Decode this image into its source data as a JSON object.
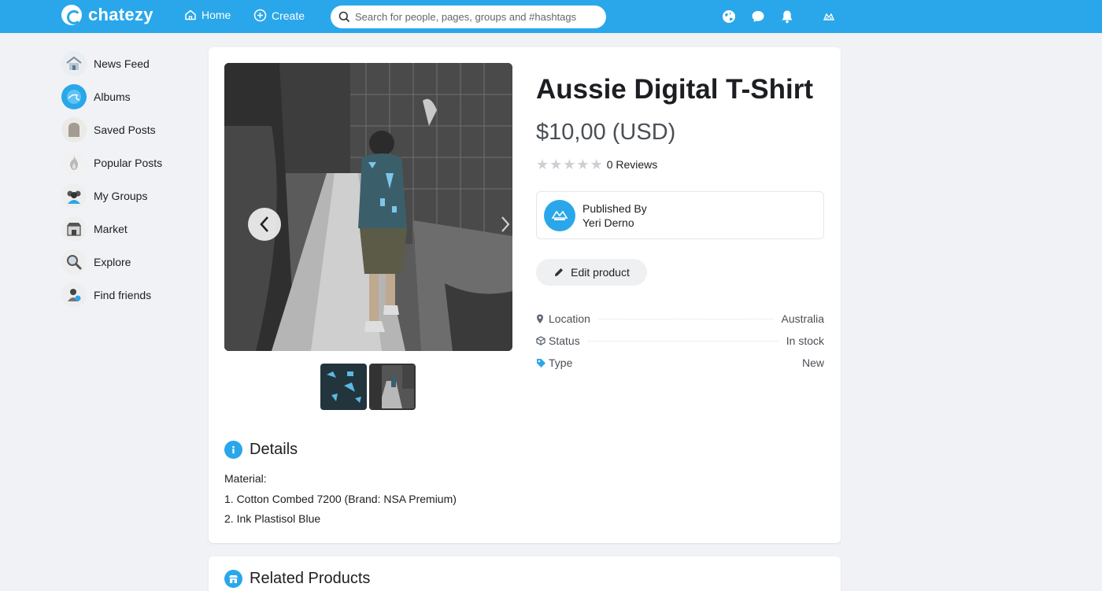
{
  "header": {
    "brand": "chatezy",
    "nav": {
      "home": "Home",
      "create": "Create"
    },
    "search_placeholder": "Search for people, pages, groups and #hashtags",
    "icons": [
      "globe-icon",
      "chat-icon",
      "bell-icon",
      "user-menu-icon"
    ],
    "brand_color": "#2aa7ea"
  },
  "sidebar": {
    "items": [
      {
        "label": "News Feed",
        "icon": "house-icon"
      },
      {
        "label": "Albums",
        "icon": "albums-icon"
      },
      {
        "label": "Saved Posts",
        "icon": "bookmark-icon"
      },
      {
        "label": "Popular Posts",
        "icon": "flame-icon"
      },
      {
        "label": "My Groups",
        "icon": "groups-icon"
      },
      {
        "label": "Market",
        "icon": "market-icon"
      },
      {
        "label": "Explore",
        "icon": "magnifier-icon"
      },
      {
        "label": "Find friends",
        "icon": "find-friends-icon"
      }
    ]
  },
  "product": {
    "title": "Aussie Digital T-Shirt",
    "price": "$10,00 (USD)",
    "rating_stars": 0,
    "reviews": "0 Reviews",
    "publisher": {
      "label": "Published By",
      "name": "Yeri Derno"
    },
    "edit_label": "Edit product",
    "attributes": [
      {
        "key": "Location",
        "value": "Australia",
        "icon": "location-pin-icon"
      },
      {
        "key": "Status",
        "value": "In stock",
        "icon": "box-icon"
      },
      {
        "key": "Type",
        "value": "New",
        "icon": "tag-icon"
      }
    ],
    "details_title": "Details",
    "details_lines": [
      "Material:",
      "1. Cotton Combed 7200 (Brand: NSA Premium)",
      "2. Ink Plastisol Blue"
    ],
    "related_title": "Related Products"
  }
}
